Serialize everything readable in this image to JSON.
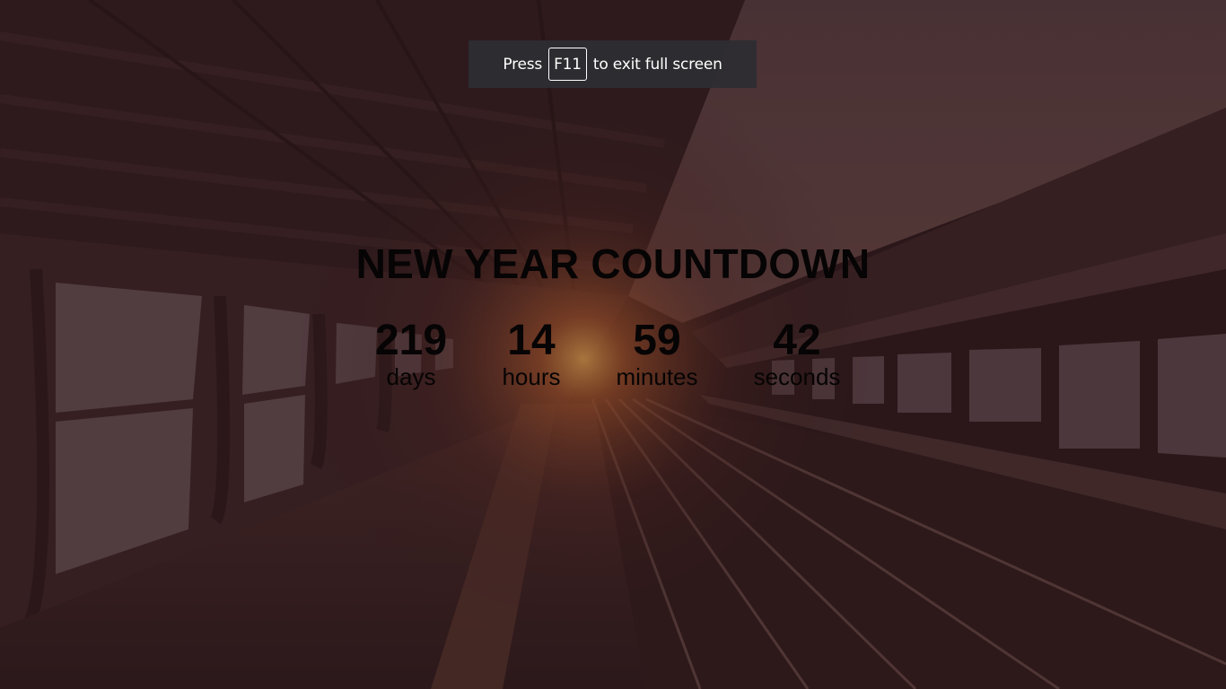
{
  "fullscreen_notice": {
    "prefix": "Press",
    "key": "F11",
    "suffix": "to exit full screen"
  },
  "countdown": {
    "title": "NEW YEAR COUNTDOWN",
    "days": {
      "value": "219",
      "label": "days"
    },
    "hours": {
      "value": "14",
      "label": "hours"
    },
    "minutes": {
      "value": "59",
      "label": "minutes"
    },
    "seconds": {
      "value": "42",
      "label": "seconds"
    }
  },
  "colors": {
    "background_tint": "#2a1a1c",
    "text": "#060404",
    "notice_bg": "#2d2d32",
    "notice_text": "#ffffff"
  },
  "background_image": "train-platform-sunset"
}
